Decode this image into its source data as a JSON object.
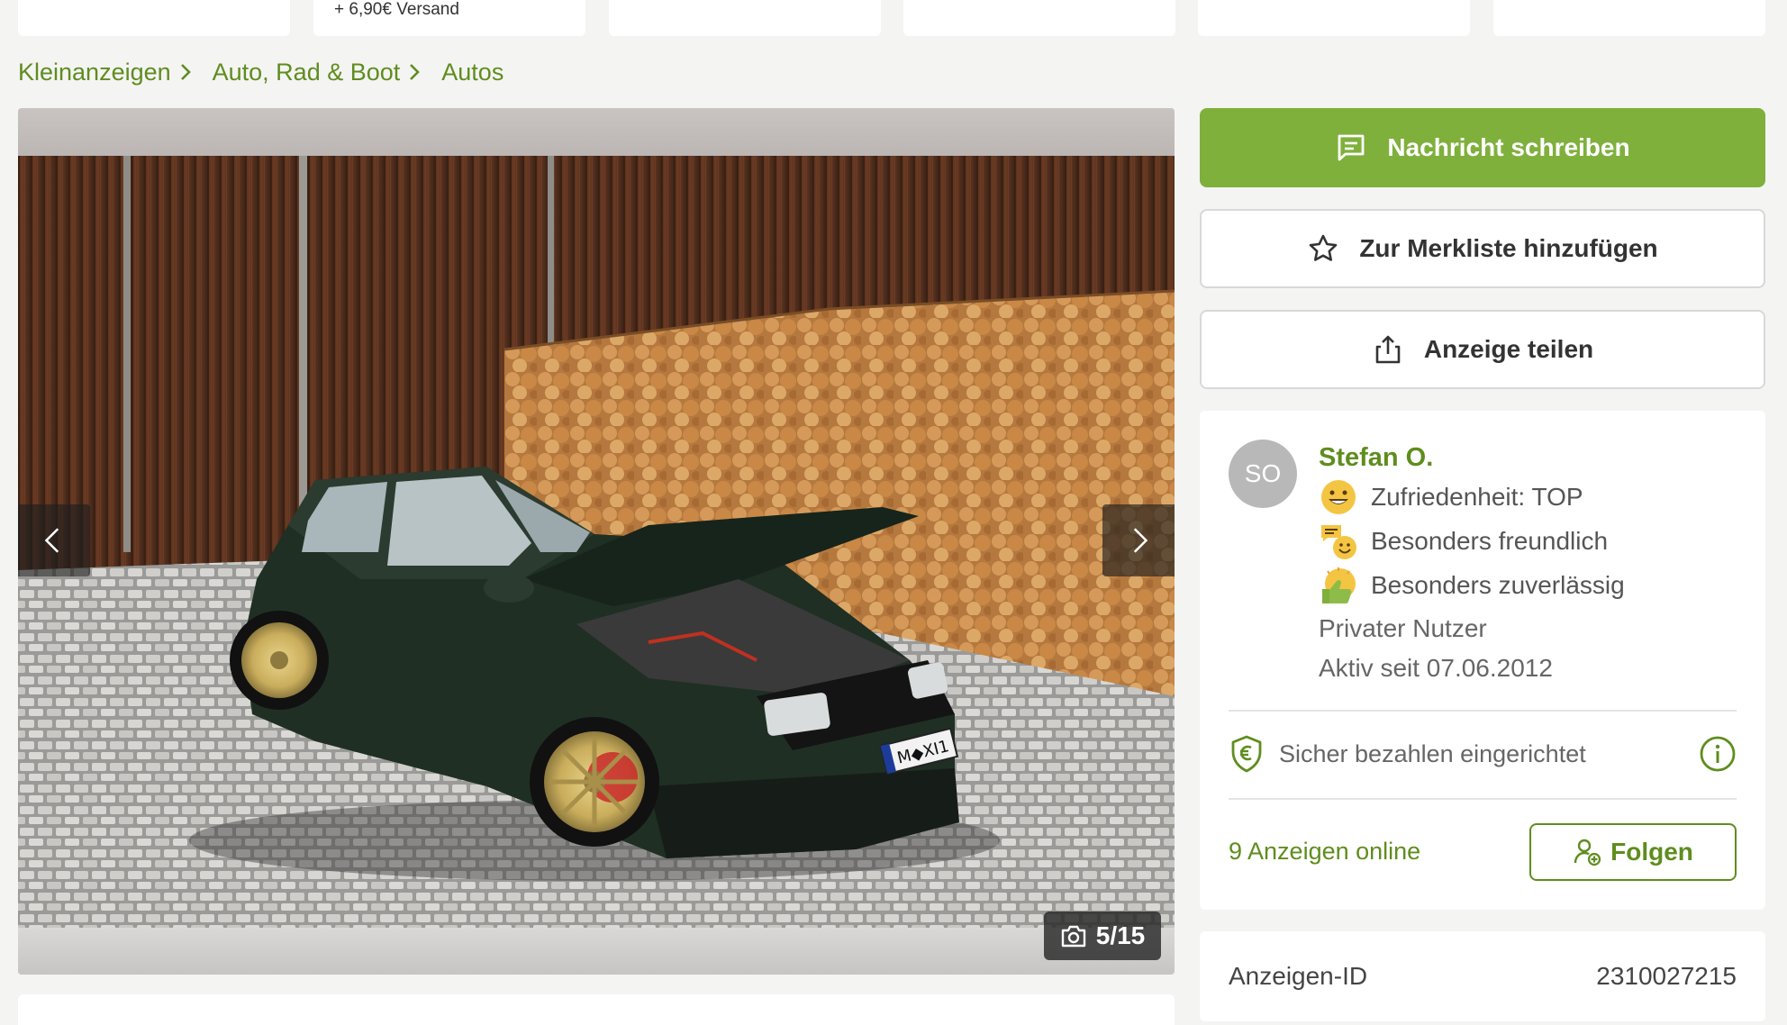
{
  "top_strip": {
    "shipping_text": "+ 6,90€ Versand"
  },
  "breadcrumb": {
    "items": [
      "Kleinanzeigen",
      "Auto, Rad & Boot",
      "Autos"
    ]
  },
  "gallery": {
    "counter": "5/15",
    "current_index": 5,
    "total": 15,
    "plate_text": "M◆XI1"
  },
  "actions": {
    "message_label": "Nachricht schreiben",
    "watchlist_label": "Zur Merkliste hinzufügen",
    "share_label": "Anzeige teilen"
  },
  "seller": {
    "initials": "SO",
    "name": "Stefan O.",
    "badges": [
      {
        "icon": "smiley-face-icon",
        "label": "Zufriedenheit: TOP"
      },
      {
        "icon": "chat-bubbles-icon",
        "label": "Besonders freundlich"
      },
      {
        "icon": "thumbs-up-icon",
        "label": "Besonders zuverlässig"
      }
    ],
    "user_type": "Privater Nutzer",
    "active_since": "Aktiv seit 07.06.2012",
    "secure_payment": "Sicher bezahlen eingerichtet",
    "ads_online": "9 Anzeigen online",
    "follow_label": "Folgen"
  },
  "ad_details": {
    "id_label": "Anzeigen-ID",
    "id_value": "2310027215"
  },
  "colors": {
    "brand_green": "#7fb03c",
    "link_green": "#5f8d1e",
    "background": "#f4f4f3"
  }
}
